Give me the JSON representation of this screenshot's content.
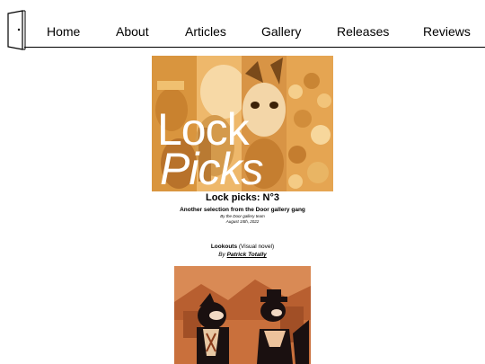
{
  "nav": {
    "logo_icon": "door-icon",
    "items": [
      {
        "label": "Home"
      },
      {
        "label": "About"
      },
      {
        "label": "Articles"
      },
      {
        "label": "Gallery"
      },
      {
        "label": "Releases"
      },
      {
        "label": "Reviews"
      }
    ]
  },
  "hero": {
    "word1": "Lock",
    "word2": "Picks",
    "tint_color": "#e7a64b"
  },
  "article": {
    "title": "Lock picks: N°3",
    "subtitle": "Another selection from the Door gallery gang",
    "byline": "By the Door gallery team",
    "date": "August 15th, 2022"
  },
  "entry": {
    "name": "Lookouts",
    "kind": "(Visual novel)",
    "by_prefix": "By",
    "author": "Patrick Totally",
    "art_color": "#c9703c"
  }
}
